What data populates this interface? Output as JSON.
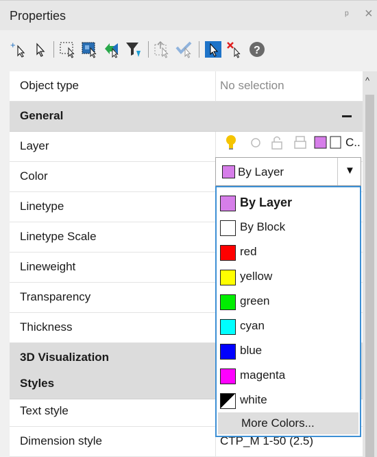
{
  "panel": {
    "title": "Properties",
    "pin_glyph": "ᵖ",
    "close_glyph": "×"
  },
  "toolbar": {
    "icons": [
      "add-selection-icon",
      "select-icon",
      "window-select-icon",
      "fence-select-icon",
      "cross-select-icon",
      "filter-select-icon",
      "quick-select-icon",
      "toggle-pickadd-icon",
      "select-objects-icon",
      "deselect-icon",
      "help-icon"
    ]
  },
  "grid": {
    "object_type": {
      "label": "Object type",
      "value": "No selection"
    },
    "general": {
      "title": "General",
      "layer": {
        "label": "Layer",
        "value": "C.."
      },
      "color": {
        "label": "Color",
        "value": "By Layer"
      },
      "linetype": {
        "label": "Linetype"
      },
      "linetype_scale": {
        "label": "Linetype Scale"
      },
      "lineweight": {
        "label": "Lineweight"
      },
      "transparency": {
        "label": "Transparency"
      },
      "thickness": {
        "label": "Thickness"
      }
    },
    "viz": {
      "title": "3D Visualization"
    },
    "styles": {
      "title": "Styles",
      "text_style": {
        "label": "Text style"
      },
      "dimension_style": {
        "label": "Dimension style",
        "value": "CTP_M 1-50 (2.5)"
      }
    }
  },
  "color_dropdown": {
    "selected": "By Layer",
    "items": [
      {
        "label": "By Layer",
        "color": "#d67ee9"
      },
      {
        "label": "By Block",
        "color": "#ffffff"
      },
      {
        "label": "red",
        "color": "#ff0000"
      },
      {
        "label": "yellow",
        "color": "#ffff00"
      },
      {
        "label": "green",
        "color": "#00ee00"
      },
      {
        "label": "cyan",
        "color": "#00ffff"
      },
      {
        "label": "blue",
        "color": "#0000ff"
      },
      {
        "label": "magenta",
        "color": "#ff00ff"
      },
      {
        "label": "white",
        "color": "#ffffff"
      }
    ],
    "more_label": "More Colors..."
  },
  "colors": {
    "layer_swatch": "#d67ee9",
    "accent_border": "#3c8fd4",
    "bulb": "#f5c400"
  }
}
